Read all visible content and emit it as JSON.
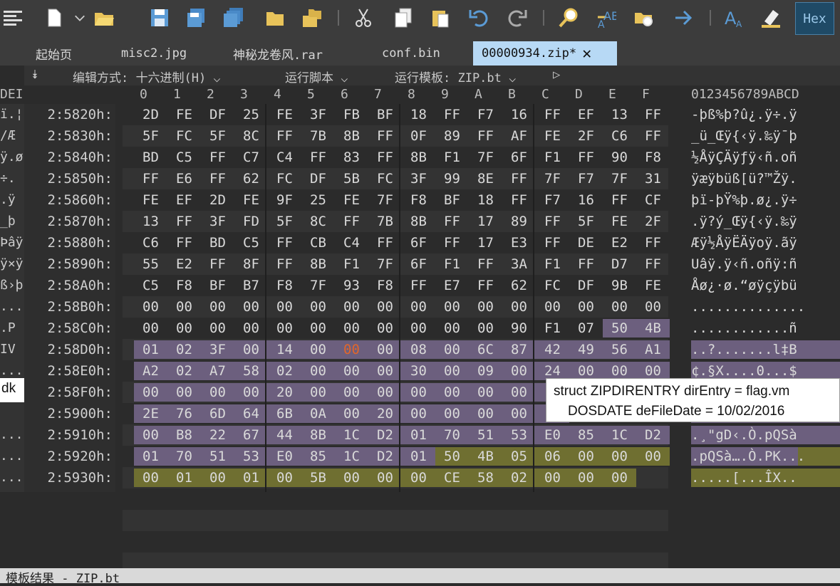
{
  "toolbar": {
    "icons": [
      "hex-editor-icon",
      "new-file-icon",
      "dropdown-arrow-icon",
      "open-folder-icon",
      "save-icon",
      "save-as-icon",
      "save-all-icon",
      "folder-icon",
      "folders-icon",
      "cut-icon",
      "copy-icon",
      "paste-icon",
      "undo-icon",
      "redo-icon",
      "find-icon",
      "find-replace-icon",
      "find-in-files-icon",
      "goto-icon",
      "font-icon",
      "highlight-icon"
    ],
    "hex_toggle": "Hex"
  },
  "tabs": [
    {
      "label": "起始页"
    },
    {
      "label": "misc2.jpg"
    },
    {
      "label": "神秘龙卷风.rar"
    },
    {
      "label": "conf.bin"
    },
    {
      "label": "00000934.zip*",
      "active": true
    }
  ],
  "subbar": {
    "edit_mode": "编辑方式: 十六进制(H)",
    "run_script": "运行脚本",
    "run_template": "运行模板: ZIP.bt"
  },
  "header": {
    "left_partial": "DEI",
    "columns": [
      "0",
      "1",
      "2",
      "3",
      "4",
      "5",
      "6",
      "7",
      "8",
      "9",
      "A",
      "B",
      "C",
      "D",
      "E",
      "F"
    ],
    "ascii_header": "0123456789ABCD"
  },
  "rows": [
    {
      "addr": "2:5820h:",
      "bytes": [
        "2D",
        "FE",
        "DF",
        "25",
        "FE",
        "3F",
        "FB",
        "BF",
        "18",
        "FF",
        "F7",
        "16",
        "FF",
        "EF",
        "13",
        "FF"
      ],
      "ascii": "-þß%þ?û¿.ÿ÷.ÿ",
      "left": "ï.¦"
    },
    {
      "addr": "2:5830h:",
      "bytes": [
        "5F",
        "FC",
        "5F",
        "8C",
        "FF",
        "7B",
        "8B",
        "FF",
        "0F",
        "89",
        "FF",
        "AF",
        "FE",
        "2F",
        "C6",
        "FF"
      ],
      "ascii": "_ü_Œÿ{‹ÿ.‰ÿ¯þ",
      "left": "/Æ"
    },
    {
      "addr": "2:5840h:",
      "bytes": [
        "BD",
        "C5",
        "FF",
        "C7",
        "C4",
        "FF",
        "83",
        "FF",
        "8B",
        "F1",
        "7F",
        "6F",
        "F1",
        "FF",
        "90",
        "F8"
      ],
      "ascii": "½ÅÿÇÄÿƒÿ‹ñ.oñ",
      "left": "ÿ.ø"
    },
    {
      "addr": "2:5850h:",
      "bytes": [
        "FF",
        "E6",
        "FF",
        "62",
        "FC",
        "DF",
        "5B",
        "FC",
        "3F",
        "99",
        "8E",
        "FF",
        "7F",
        "F7",
        "7F",
        "31"
      ],
      "ascii": "ÿæÿbüß[ü?™Žÿ.",
      "left": "÷."
    },
    {
      "addr": "2:5860h:",
      "bytes": [
        "FE",
        "EF",
        "2D",
        "FE",
        "9F",
        "25",
        "FE",
        "7F",
        "F8",
        "BF",
        "18",
        "FF",
        "F7",
        "16",
        "FF",
        "CF"
      ],
      "ascii": "þï-þŸ%þ.ø¿.ÿ÷",
      "left": ".ÿ"
    },
    {
      "addr": "2:5870h:",
      "bytes": [
        "13",
        "FF",
        "3F",
        "FD",
        "5F",
        "8C",
        "FF",
        "7B",
        "8B",
        "FF",
        "17",
        "89",
        "FF",
        "5F",
        "FE",
        "2F"
      ],
      "ascii": ".ÿ?ý_Œÿ{‹ÿ.‰ÿ",
      "left": "_þ"
    },
    {
      "addr": "2:5880h:",
      "bytes": [
        "C6",
        "FF",
        "BD",
        "C5",
        "FF",
        "CB",
        "C4",
        "FF",
        "6F",
        "FF",
        "17",
        "E3",
        "FF",
        "DE",
        "E2",
        "FF"
      ],
      "ascii": "Æÿ½ÅÿËÄÿoÿ.ãÿ",
      "left": "Þâÿ"
    },
    {
      "addr": "2:5890h:",
      "bytes": [
        "55",
        "E2",
        "FF",
        "8F",
        "FF",
        "8B",
        "F1",
        "7F",
        "6F",
        "F1",
        "FF",
        "3A",
        "F1",
        "FF",
        "D7",
        "FF"
      ],
      "ascii": "Uâÿ.ÿ‹ñ.oñÿ:ñ",
      "left": "ÿ×ÿ"
    },
    {
      "addr": "2:58A0h:",
      "bytes": [
        "C5",
        "F8",
        "BF",
        "B7",
        "F8",
        "7F",
        "93",
        "F8",
        "FF",
        "E7",
        "FF",
        "62",
        "FC",
        "DF",
        "9B",
        "FE"
      ],
      "ascii": "Åø¿·ø.“øÿçÿbü",
      "left": "ß›þ"
    },
    {
      "addr": "2:58B0h:",
      "bytes": [
        "00",
        "00",
        "00",
        "00",
        "00",
        "00",
        "00",
        "00",
        "00",
        "00",
        "00",
        "00",
        "00",
        "00",
        "00",
        "00"
      ],
      "ascii": "..............",
      "left": "..."
    },
    {
      "addr": "2:58C0h:",
      "bytes": [
        "00",
        "00",
        "00",
        "00",
        "00",
        "00",
        "00",
        "00",
        "00",
        "00",
        "00",
        "90",
        "F1",
        "07",
        "50",
        "4B"
      ],
      "ascii": "............ñ",
      "left": ".P"
    },
    {
      "addr": "2:58D0h:",
      "bytes": [
        "01",
        "02",
        "3F",
        "00",
        "14",
        "00",
        "00",
        "00",
        "08",
        "00",
        "6C",
        "87",
        "42",
        "49",
        "56",
        "A1"
      ],
      "ascii": "..?.......l‡B",
      "left": "IV"
    },
    {
      "addr": "2:58E0h:",
      "bytes": [
        "A2",
        "02",
        "A7",
        "58",
        "02",
        "00",
        "00",
        "00",
        "30",
        "00",
        "09",
        "00",
        "24",
        "00",
        "00",
        "00"
      ],
      "ascii": "¢.§X....0...$",
      "left": "..."
    },
    {
      "addr": "2:58F0h:",
      "bytes": [
        "00",
        "00",
        "00",
        "00",
        "20",
        "00",
        "00",
        "00",
        "00",
        "00",
        "00",
        "00",
        "6",
        "",
        "",
        ""
      ],
      "ascii": "",
      "left": "dk"
    },
    {
      "addr": "2:5900h:",
      "bytes": [
        "2E",
        "76",
        "6D",
        "64",
        "6B",
        "0A",
        "00",
        "20",
        "00",
        "00",
        "00",
        "00",
        "0",
        "",
        "",
        ""
      ],
      "ascii": "",
      "left": ""
    },
    {
      "addr": "2:5910h:",
      "bytes": [
        "00",
        "B8",
        "22",
        "67",
        "44",
        "8B",
        "1C",
        "D2",
        "01",
        "70",
        "51",
        "53",
        "E0",
        "85",
        "1C",
        "D2"
      ],
      "ascii": ".¸\"gD‹.Ò.pQSà",
      "left": "..."
    },
    {
      "addr": "2:5920h:",
      "bytes": [
        "01",
        "70",
        "51",
        "53",
        "E0",
        "85",
        "1C",
        "D2",
        "01",
        "50",
        "4B",
        "05",
        "06",
        "00",
        "00",
        "00"
      ],
      "ascii": ".pQSà….Ò.PK...",
      "left": "..."
    },
    {
      "addr": "2:5930h:",
      "bytes": [
        "00",
        "01",
        "00",
        "01",
        "00",
        "5B",
        "00",
        "00",
        "00",
        "CE",
        "58",
        "02",
        "00",
        "00",
        "00",
        ""
      ],
      "ascii": ".....[...ÎX..",
      "left": "..."
    }
  ],
  "tooltip": {
    "line1": "struct ZIPDIRENTRY dirEntry = flag.vm",
    "line2": "DOSDATE deFileDate = 10/02/2016"
  },
  "bottom": {
    "title": "模板结果 - ZIP.bt"
  },
  "colors": {
    "dir_entry_highlight": "#6c5f7e",
    "end_record_highlight": "#6f6f31",
    "active_tab": "#b7d9f5",
    "cursor_byte": "#e0662c",
    "selected_ascii": "#1f8aa0"
  }
}
